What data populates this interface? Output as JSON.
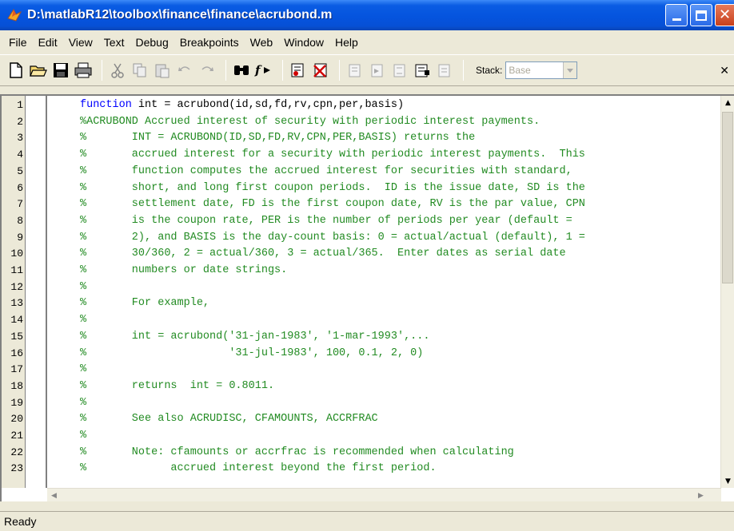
{
  "window": {
    "title": "D:\\matlabR12\\toolbox\\finance\\finance\\acrubond.m"
  },
  "menu": [
    {
      "label": "File"
    },
    {
      "label": "Edit"
    },
    {
      "label": "View"
    },
    {
      "label": "Text"
    },
    {
      "label": "Debug"
    },
    {
      "label": "Breakpoints"
    },
    {
      "label": "Web"
    },
    {
      "label": "Window"
    },
    {
      "label": "Help"
    }
  ],
  "toolbar": {
    "stack_label": "Stack:",
    "stack_value": "Base",
    "icons": [
      "new-file-icon",
      "open-folder-icon",
      "save-icon",
      "print-icon",
      "cut-icon",
      "copy-icon",
      "paste-icon",
      "undo-icon",
      "redo-icon",
      "find-icon",
      "function-icon",
      "set-breakpoint-icon",
      "clear-breakpoints-icon",
      "step-icon",
      "step-in-icon",
      "step-out-icon",
      "continue-icon",
      "exit-debug-icon"
    ]
  },
  "code": {
    "lines": [
      {
        "n": "1",
        "kw": "function",
        "text": " int = acrubond(id,sd,fd,rv,cpn,per,basis)",
        "comment": ""
      },
      {
        "n": "2",
        "kw": "",
        "text": "",
        "comment": "%ACRUBOND Accrued interest of security with periodic interest payments."
      },
      {
        "n": "3",
        "kw": "",
        "text": "",
        "comment": "%       INT = ACRUBOND(ID,SD,FD,RV,CPN,PER,BASIS) returns the"
      },
      {
        "n": "4",
        "kw": "",
        "text": "",
        "comment": "%       accrued interest for a security with periodic interest payments.  This"
      },
      {
        "n": "5",
        "kw": "",
        "text": "",
        "comment": "%       function computes the accrued interest for securities with standard,"
      },
      {
        "n": "6",
        "kw": "",
        "text": "",
        "comment": "%       short, and long first coupon periods.  ID is the issue date, SD is the"
      },
      {
        "n": "7",
        "kw": "",
        "text": "",
        "comment": "%       settlement date, FD is the first coupon date, RV is the par value, CPN"
      },
      {
        "n": "8",
        "kw": "",
        "text": "",
        "comment": "%       is the coupon rate, PER is the number of periods per year (default ="
      },
      {
        "n": "9",
        "kw": "",
        "text": "",
        "comment": "%       2), and BASIS is the day-count basis: 0 = actual/actual (default), 1 ="
      },
      {
        "n": "10",
        "kw": "",
        "text": "",
        "comment": "%       30/360, 2 = actual/360, 3 = actual/365.  Enter dates as serial date"
      },
      {
        "n": "11",
        "kw": "",
        "text": "",
        "comment": "%       numbers or date strings."
      },
      {
        "n": "12",
        "kw": "",
        "text": "",
        "comment": "%"
      },
      {
        "n": "13",
        "kw": "",
        "text": "",
        "comment": "%       For example,"
      },
      {
        "n": "14",
        "kw": "",
        "text": "",
        "comment": "%"
      },
      {
        "n": "15",
        "kw": "",
        "text": "",
        "comment": "%       int = acrubond('31-jan-1983', '1-mar-1993',..."
      },
      {
        "n": "16",
        "kw": "",
        "text": "",
        "comment": "%                      '31-jul-1983', 100, 0.1, 2, 0)"
      },
      {
        "n": "17",
        "kw": "",
        "text": "",
        "comment": "%"
      },
      {
        "n": "18",
        "kw": "",
        "text": "",
        "comment": "%       returns  int = 0.8011."
      },
      {
        "n": "19",
        "kw": "",
        "text": "",
        "comment": "%"
      },
      {
        "n": "20",
        "kw": "",
        "text": "",
        "comment": "%       See also ACRUDISC, CFAMOUNTS, ACCRFRAC"
      },
      {
        "n": "21",
        "kw": "",
        "text": "",
        "comment": "%"
      },
      {
        "n": "22",
        "kw": "",
        "text": "",
        "comment": "%       Note: cfamounts or accrfrac is recommended when calculating"
      },
      {
        "n": "23",
        "kw": "",
        "text": "",
        "comment": "%             accrued interest beyond the first period."
      }
    ]
  },
  "status": {
    "text": "Ready"
  }
}
